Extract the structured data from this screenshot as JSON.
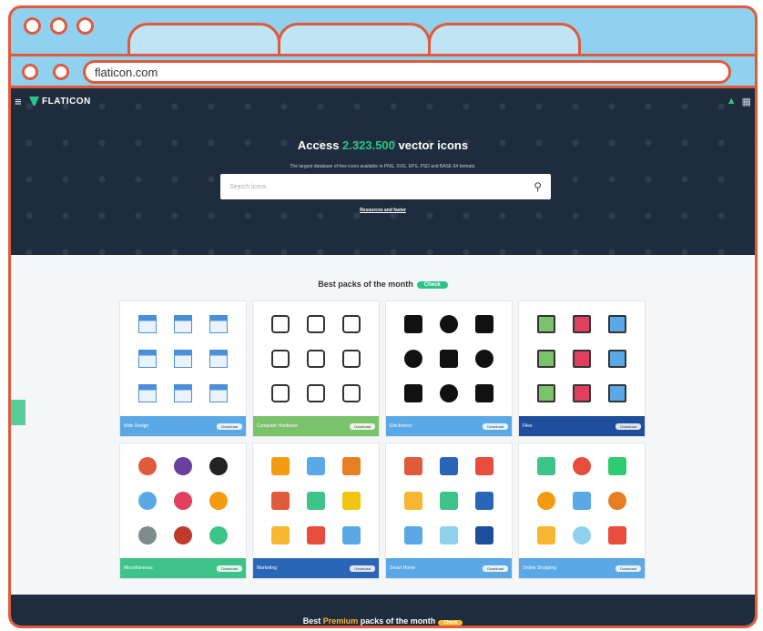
{
  "browser": {
    "url": "flaticon.com"
  },
  "header": {
    "logo": "FLATICON"
  },
  "hero": {
    "title_prefix": "Access ",
    "title_count": "2.323.500",
    "title_suffix": " vector icons",
    "subtitle": "The largest database of free icons available in PNG, SVG, EPS, PSD and BASE 64 formats.",
    "search_placeholder": "Search icons",
    "link": "Resources and faster"
  },
  "packs": {
    "title": "Best packs of the month",
    "badge": "Check",
    "cards": [
      {
        "name": "Web Design",
        "btn": "Download",
        "color": "#5aa9e6",
        "theme": "blueflat"
      },
      {
        "name": "Computer Hardware",
        "btn": "Download",
        "color": "#7ac36a",
        "theme": "outline"
      },
      {
        "name": "Electronics",
        "btn": "Download",
        "color": "#5aa9e6",
        "theme": "glyph"
      },
      {
        "name": "Files",
        "btn": "Download",
        "color": "#1f4e9c",
        "theme": "files"
      },
      {
        "name": "Miscellaneous",
        "btn": "Download",
        "color": "#3ec48a",
        "theme": "circles"
      },
      {
        "name": "Marketing",
        "btn": "Download",
        "color": "#2a66b8",
        "theme": "flatcolor"
      },
      {
        "name": "Smart Home",
        "btn": "Download",
        "color": "#5aa9e6",
        "theme": "flatcolor2"
      },
      {
        "name": "Online Shopping",
        "btn": "Download",
        "color": "#5aa9e6",
        "theme": "flatcolor3"
      }
    ]
  },
  "bottom": {
    "prefix": "Best ",
    "premium": "Premium",
    "suffix": " packs of the month",
    "badge": "Check"
  }
}
